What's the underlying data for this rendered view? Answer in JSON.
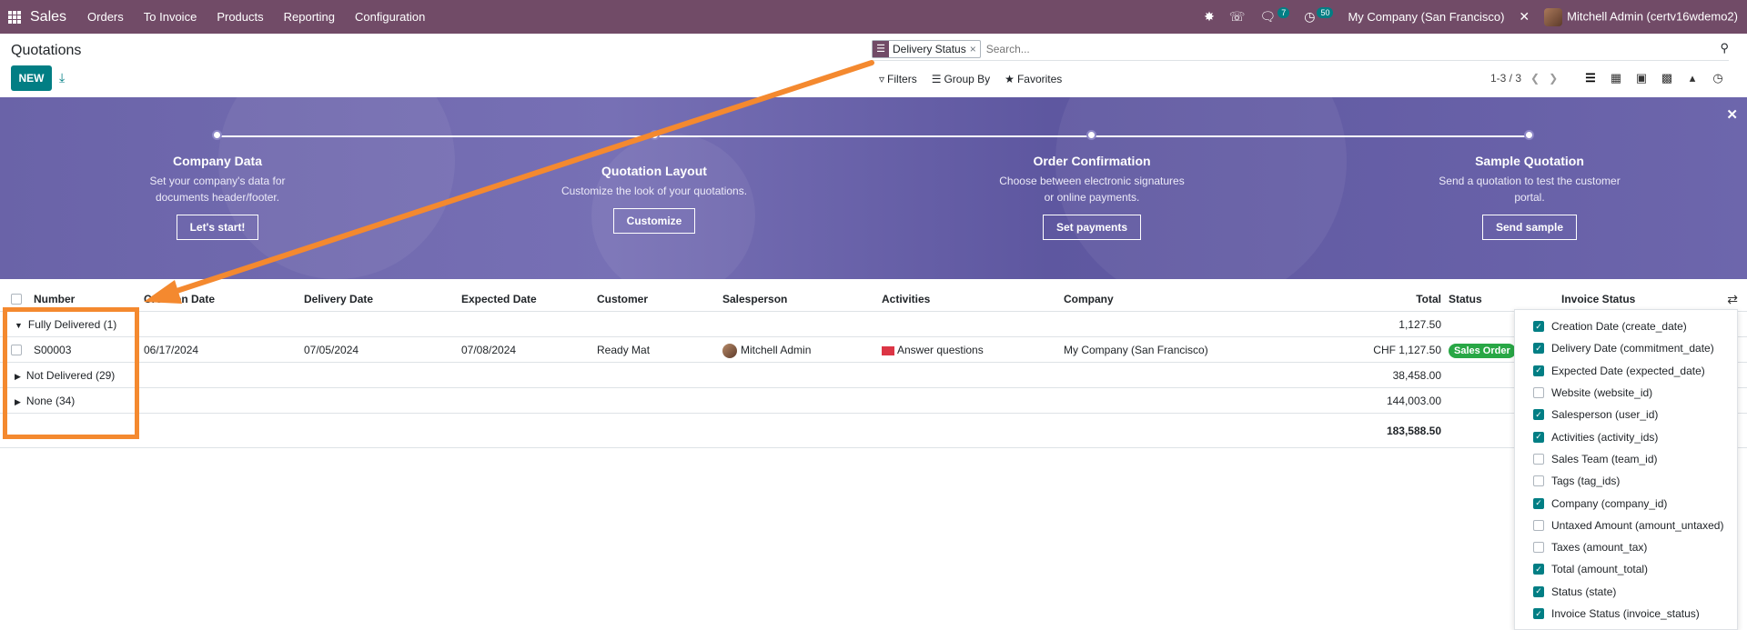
{
  "navbar": {
    "app_name": "Sales",
    "menu": [
      "Orders",
      "To Invoice",
      "Products",
      "Reporting",
      "Configuration"
    ],
    "messages_count": "7",
    "activities_count": "50",
    "company": "My Company (San Francisco)",
    "user": "Mitchell Admin (certv16wdemo2)"
  },
  "control_panel": {
    "title": "Quotations",
    "new_label": "NEW",
    "facet_label": "Delivery Status",
    "search_placeholder": "Search...",
    "filters_label": "Filters",
    "groupby_label": "Group By",
    "favorites_label": "Favorites",
    "pager": "1-3 / 3"
  },
  "banner": {
    "steps": [
      {
        "title": "Company Data",
        "desc1": "Set your company's data for",
        "desc2": "documents header/footer.",
        "button": "Let's start!"
      },
      {
        "title": "Quotation Layout",
        "desc1": "Customize the look of your quotations.",
        "desc2": "",
        "button": "Customize"
      },
      {
        "title": "Order Confirmation",
        "desc1": "Choose between electronic signatures",
        "desc2": "or online payments.",
        "button": "Set payments"
      },
      {
        "title": "Sample Quotation",
        "desc1": "Send a quotation to test the customer",
        "desc2": "portal.",
        "button": "Send sample"
      }
    ]
  },
  "table": {
    "headers": {
      "number": "Number",
      "creation_date": "Creation Date",
      "delivery_date": "Delivery Date",
      "expected_date": "Expected Date",
      "customer": "Customer",
      "salesperson": "Salesperson",
      "activities": "Activities",
      "company": "Company",
      "total": "Total",
      "status": "Status",
      "invoice_status": "Invoice Status"
    },
    "groups": [
      {
        "label": "Fully Delivered (1)",
        "total": "1,127.50"
      },
      {
        "label": "Not Delivered (29)",
        "total": "38,458.00"
      },
      {
        "label": "None (34)",
        "total": "144,003.00"
      }
    ],
    "record": {
      "number": "S00003",
      "creation_date": "06/17/2024",
      "delivery_date": "07/05/2024",
      "expected_date": "07/08/2024",
      "customer": "Ready Mat",
      "salesperson": "Mitchell Admin",
      "activity": "Answer questions",
      "company": "My Company (San Francisco)",
      "total": "CHF 1,127.50",
      "status": "Sales Order"
    },
    "grand_total": "183,588.50"
  },
  "optional_columns": [
    {
      "label": "Creation Date (create_date)",
      "checked": true
    },
    {
      "label": "Delivery Date (commitment_date)",
      "checked": true
    },
    {
      "label": "Expected Date (expected_date)",
      "checked": true
    },
    {
      "label": "Website (website_id)",
      "checked": false
    },
    {
      "label": "Salesperson (user_id)",
      "checked": true
    },
    {
      "label": "Activities (activity_ids)",
      "checked": true
    },
    {
      "label": "Sales Team (team_id)",
      "checked": false
    },
    {
      "label": "Tags (tag_ids)",
      "checked": false
    },
    {
      "label": "Company (company_id)",
      "checked": true
    },
    {
      "label": "Untaxed Amount (amount_untaxed)",
      "checked": false
    },
    {
      "label": "Taxes (amount_tax)",
      "checked": false
    },
    {
      "label": "Total (amount_total)",
      "checked": true
    },
    {
      "label": "Status (state)",
      "checked": true
    },
    {
      "label": "Invoice Status (invoice_status)",
      "checked": true
    }
  ],
  "colors": {
    "navbar": "#714b67",
    "primary": "#017e84",
    "annotation": "#f4892f",
    "banner": "#6a63a8",
    "status_badge": "#28a745"
  }
}
